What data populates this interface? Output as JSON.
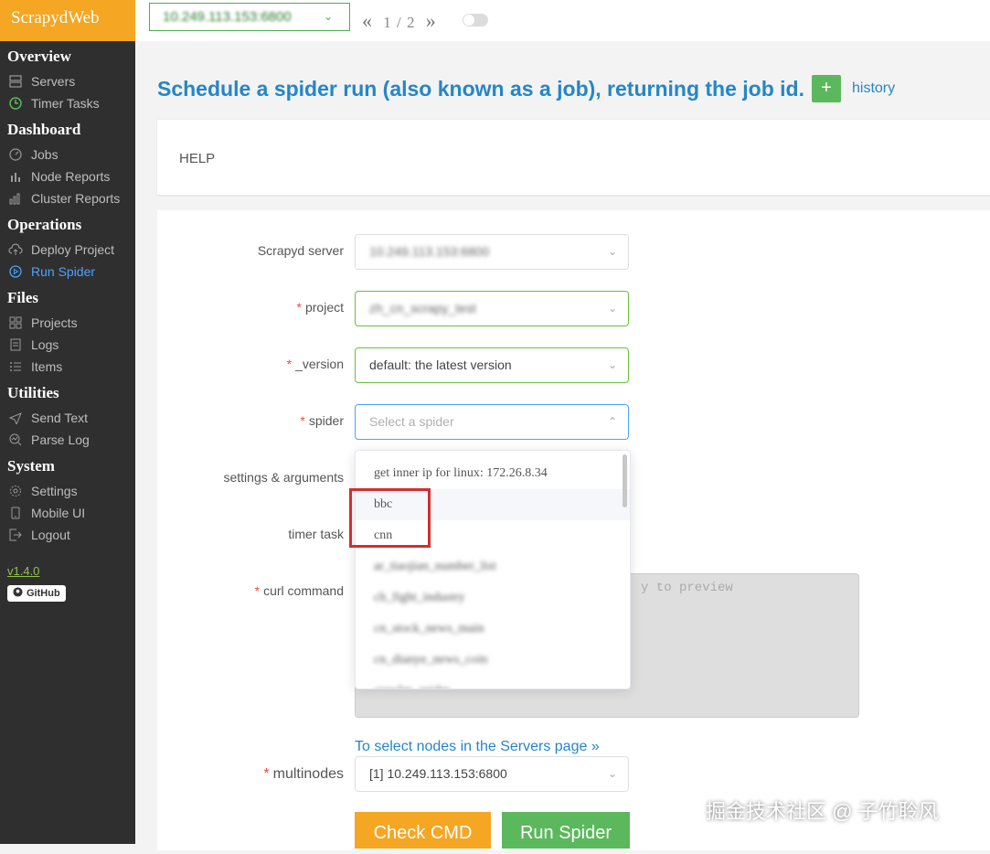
{
  "brand": "ScrapydWeb",
  "sidebar": {
    "groups": [
      {
        "title": "Overview",
        "items": [
          {
            "label": "Servers",
            "icon": "servers-icon"
          },
          {
            "label": "Timer Tasks",
            "icon": "timer-icon"
          }
        ]
      },
      {
        "title": "Dashboard",
        "items": [
          {
            "label": "Jobs",
            "icon": "gauge-icon"
          },
          {
            "label": "Node Reports",
            "icon": "bar-chart-icon"
          },
          {
            "label": "Cluster Reports",
            "icon": "cluster-chart-icon"
          }
        ]
      },
      {
        "title": "Operations",
        "items": [
          {
            "label": "Deploy Project",
            "icon": "cloud-upload-icon"
          },
          {
            "label": "Run Spider",
            "icon": "play-icon"
          }
        ]
      },
      {
        "title": "Files",
        "items": [
          {
            "label": "Projects",
            "icon": "grid-icon"
          },
          {
            "label": "Logs",
            "icon": "document-icon"
          },
          {
            "label": "Items",
            "icon": "list-icon"
          }
        ]
      },
      {
        "title": "Utilities",
        "items": [
          {
            "label": "Send Text",
            "icon": "send-icon"
          },
          {
            "label": "Parse Log",
            "icon": "chart-search-icon"
          }
        ]
      },
      {
        "title": "System",
        "items": [
          {
            "label": "Settings",
            "icon": "gear-icon"
          },
          {
            "label": "Mobile UI",
            "icon": "mobile-icon"
          },
          {
            "label": "Logout",
            "icon": "logout-icon"
          }
        ]
      }
    ],
    "version": "v1.4.0",
    "github": "GitHub"
  },
  "topbar": {
    "node_value": "10.249.113.153:6800",
    "pager_prev": "«",
    "pager_text": "1 / 2",
    "pager_next": "»"
  },
  "page": {
    "title": "Schedule a spider run (also known as a job), returning the job id.",
    "plus": "+",
    "history": "history"
  },
  "help": "HELP",
  "form": {
    "server_label": "Scrapyd server",
    "server_value": "10.249.113.153:6800",
    "project_label": "project",
    "project_value": "zh_cn_scrapy_test",
    "version_label": "_version",
    "version_value": "default: the latest version",
    "spider_label": "spider",
    "spider_placeholder": "Select a spider",
    "settings_label": "settings & arguments",
    "timer_label": "timer task",
    "curl_label": "curl command",
    "curl_placeholder": "y to preview",
    "required_mark": "*",
    "select_nodes_link": "To select nodes in the Servers page »",
    "multinodes_label": "multinodes",
    "multinodes_value": "[1] 10.249.113.153:6800",
    "check_cmd": "Check CMD",
    "run_spider": "Run Spider"
  },
  "dropdown": {
    "options": [
      "get inner ip for linux: 172.26.8.34",
      "bbc",
      "cnn",
      "ar_tiaojian_number_list",
      "ch_fight_industry",
      "cn_stock_news_main",
      "cn_dianye_news_coin",
      "crawler_spider"
    ]
  },
  "watermark": "掘金技术社区 @ 子竹聆风",
  "colors": {
    "accent": "#2486c9",
    "brand": "#f5a623",
    "success": "#5cb85c",
    "highlight": "#d32f2f"
  }
}
